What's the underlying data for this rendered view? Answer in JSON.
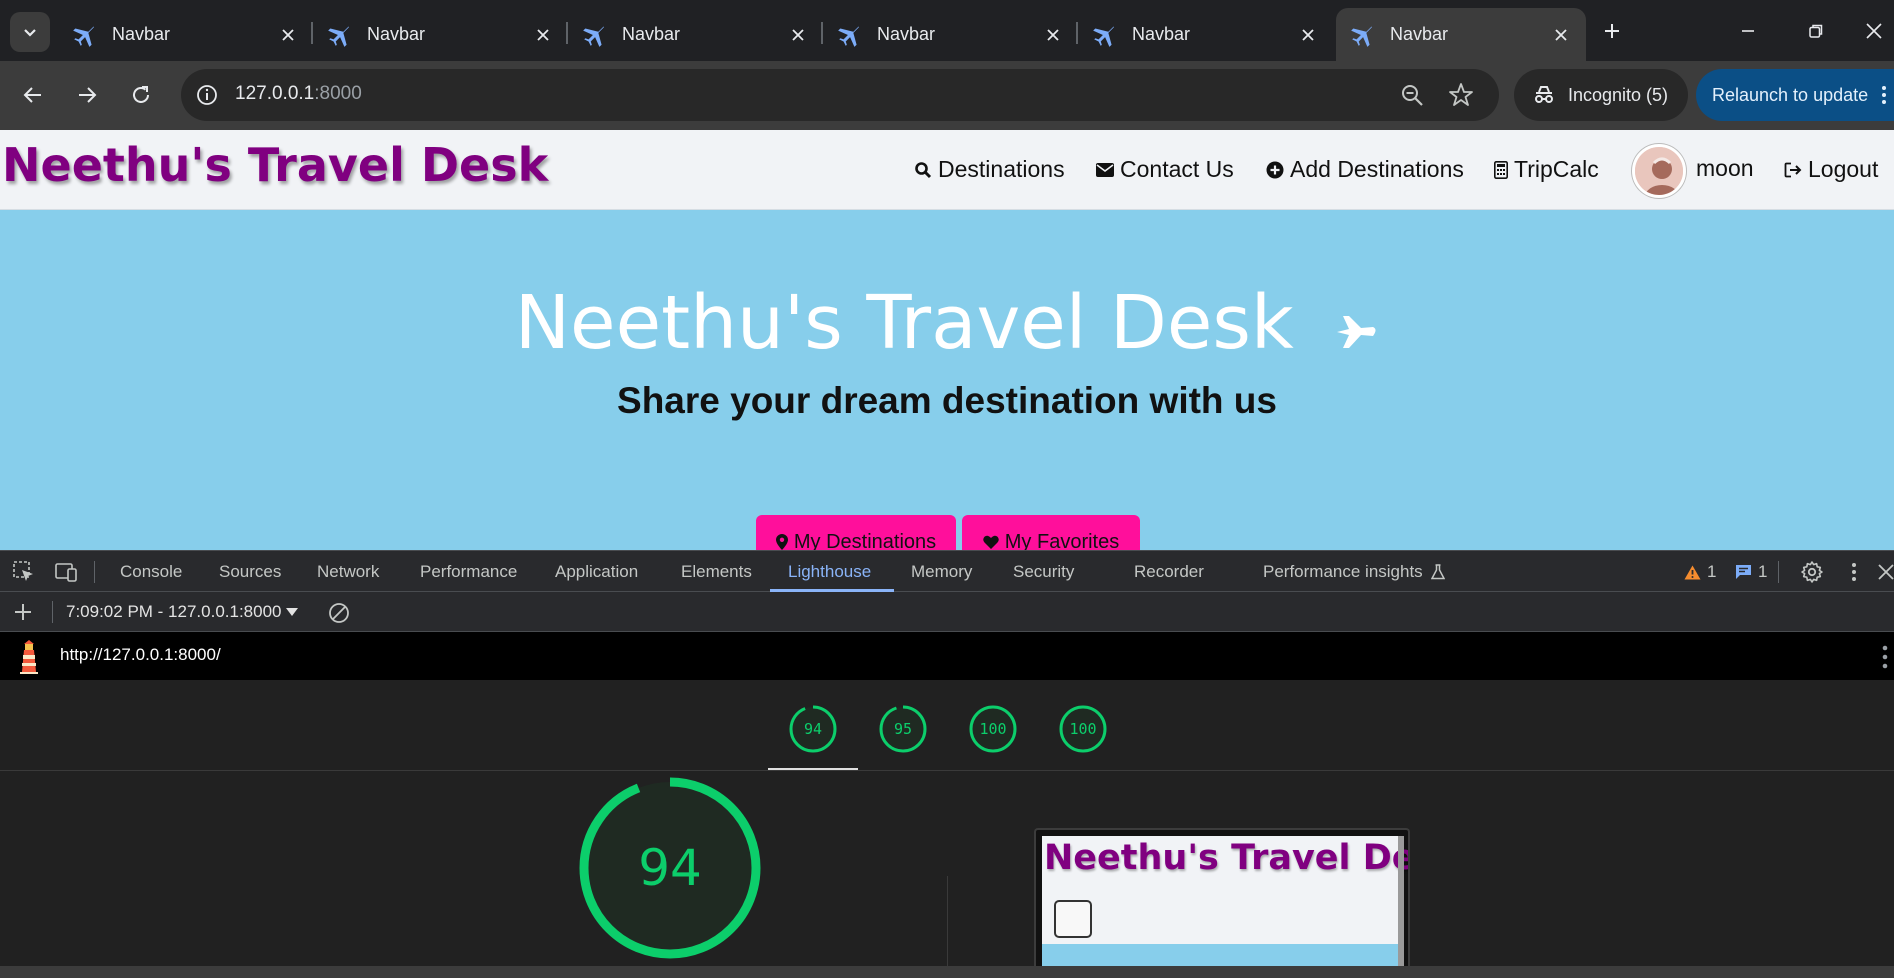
{
  "browser": {
    "tabs": [
      {
        "title": "Navbar",
        "active": false
      },
      {
        "title": "Navbar",
        "active": false
      },
      {
        "title": "Navbar",
        "active": false
      },
      {
        "title": "Navbar",
        "active": false
      },
      {
        "title": "Navbar",
        "active": false
      },
      {
        "title": "Navbar",
        "active": true
      }
    ],
    "url_host": "127.0.0.1",
    "url_port": ":8000",
    "incognito_label": "Incognito (5)",
    "relaunch_label": "Relaunch to update"
  },
  "site": {
    "brand": "Neethu's Travel Desk",
    "nav": {
      "destinations": "Destinations",
      "contact": "Contact Us",
      "add_destinations": "Add Destinations",
      "tripcalc": "TripCalc",
      "username": "moon",
      "logout": "Logout"
    },
    "hero_title": "Neethu's Travel Desk",
    "hero_subtitle": "Share your dream destination with us",
    "btn_my_destinations": "My Destinations",
    "btn_my_favorites": "My Favorites"
  },
  "devtools": {
    "tabs": [
      "Console",
      "Sources",
      "Network",
      "Performance",
      "Application",
      "Elements",
      "Lighthouse",
      "Memory",
      "Security",
      "Recorder",
      "Performance insights"
    ],
    "active_tab": "Lighthouse",
    "warnings_count": "1",
    "messages_count": "1",
    "report_selector": "7:09:02 PM - 127.0.0.1:8000",
    "audited_url": "http://127.0.0.1:8000/",
    "scores": [
      "94",
      "95",
      "100",
      "100"
    ],
    "main_score": "94",
    "score_color": "#0cce6b"
  },
  "thumbnail": {
    "brand": "Neethu's Travel Desk"
  }
}
